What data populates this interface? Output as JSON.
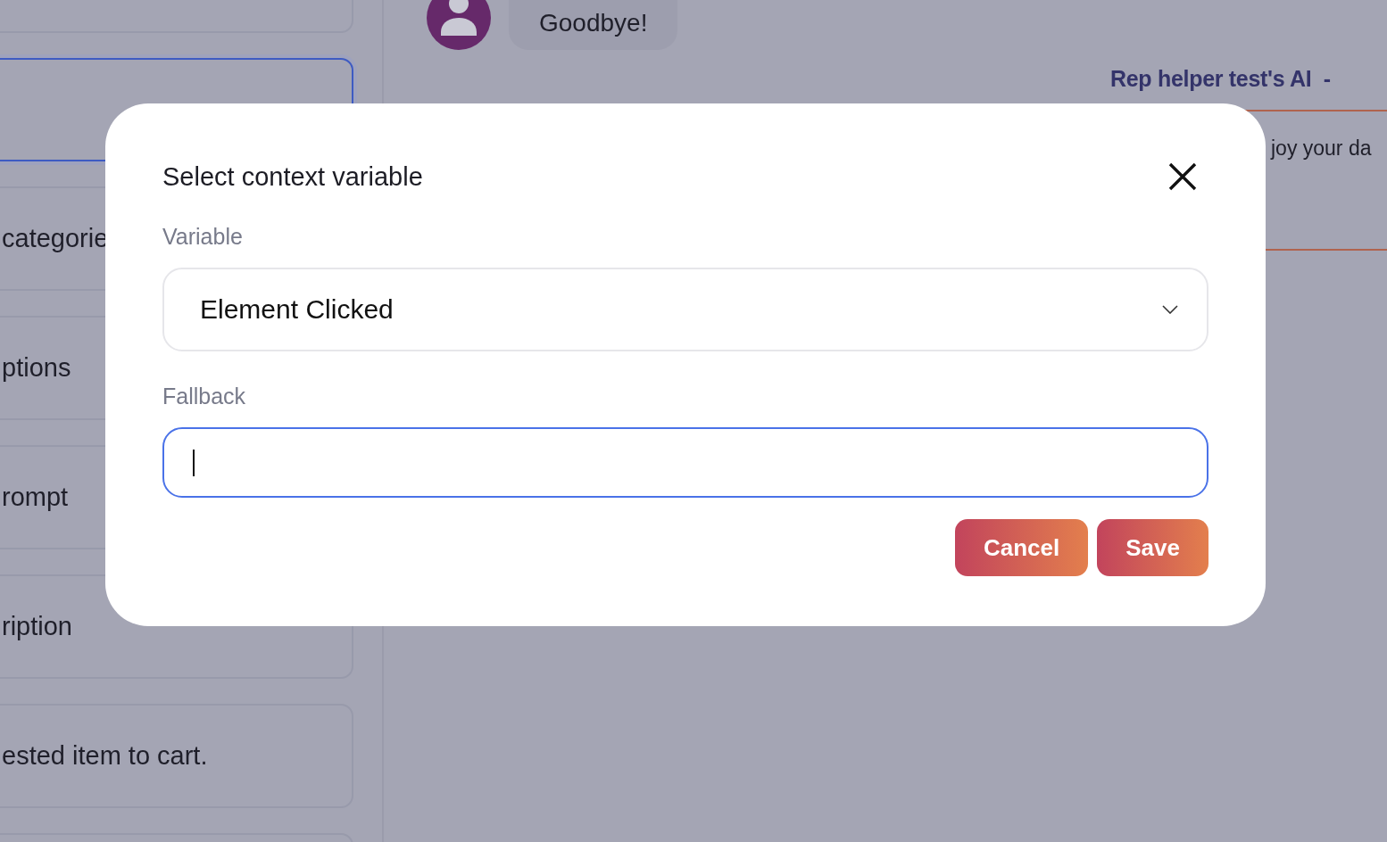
{
  "sidebar": {
    "cards": [
      {
        "selected": false
      },
      {
        "selected": true
      },
      {
        "selected": false,
        "text": "categorie"
      },
      {
        "selected": false,
        "text": "ptions"
      },
      {
        "selected": false,
        "text": "rompt"
      },
      {
        "selected": false,
        "text": "ription"
      },
      {
        "selected": false,
        "text": "ested item to cart."
      },
      {
        "selected": false
      }
    ]
  },
  "chat": {
    "messages": [
      {
        "text": "Goodbye!"
      }
    ],
    "ai_reply": {
      "title": "Rep helper test's AI  -",
      "text": "joy your da"
    }
  },
  "dialog": {
    "title": "Select context variable",
    "fields": [
      {
        "kind": "select",
        "label": "Variable",
        "value": "Element Clicked"
      },
      {
        "kind": "text",
        "label": "Fallback",
        "focused": true
      }
    ],
    "buttons": [
      "Cancel",
      "Save"
    ]
  }
}
